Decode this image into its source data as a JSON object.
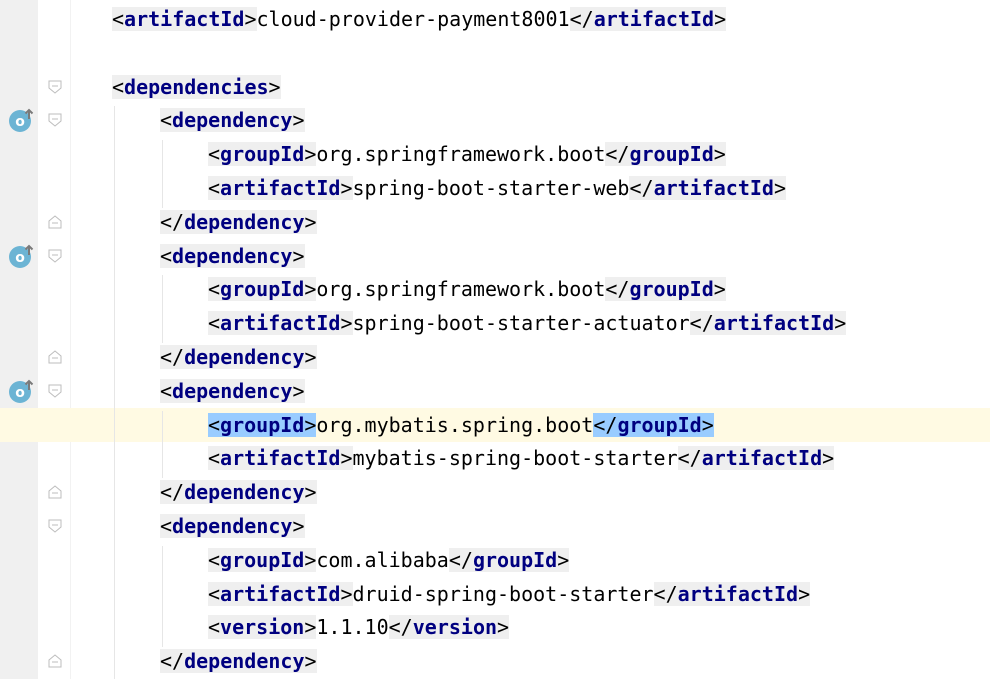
{
  "editor": {
    "lines": [
      {
        "indent": 0,
        "tag": "artifactId",
        "value": "cloud-provider-payment8001",
        "close": "artifactId",
        "fold": "",
        "marker": false,
        "current": false
      },
      {
        "indent": -1
      },
      {
        "indent": 0,
        "tag": "dependencies",
        "fold": "open",
        "marker": false,
        "current": false
      },
      {
        "indent": 1,
        "tag": "dependency",
        "fold": "open",
        "marker": true,
        "current": false
      },
      {
        "indent": 2,
        "tag": "groupId",
        "value": "org.springframework.boot",
        "close": "groupId"
      },
      {
        "indent": 2,
        "tag": "artifactId",
        "value": "spring-boot-starter-web",
        "close": "artifactId"
      },
      {
        "indent": 1,
        "closeOnly": "dependency",
        "fold": "close"
      },
      {
        "indent": 1,
        "tag": "dependency",
        "fold": "open",
        "marker": true
      },
      {
        "indent": 2,
        "tag": "groupId",
        "value": "org.springframework.boot",
        "close": "groupId"
      },
      {
        "indent": 2,
        "tag": "artifactId",
        "value": "spring-boot-starter-actuator",
        "close": "artifactId"
      },
      {
        "indent": 1,
        "closeOnly": "dependency",
        "fold": "close"
      },
      {
        "indent": 1,
        "tag": "dependency",
        "fold": "open",
        "marker": true
      },
      {
        "indent": 2,
        "tag": "groupId",
        "value": "org.mybatis.spring.boot",
        "close": "groupId",
        "current": true,
        "highlight": true
      },
      {
        "indent": 2,
        "tag": "artifactId",
        "value": "mybatis-spring-boot-starter",
        "close": "artifactId"
      },
      {
        "indent": 1,
        "closeOnly": "dependency",
        "fold": "close"
      },
      {
        "indent": 1,
        "tag": "dependency",
        "fold": "open"
      },
      {
        "indent": 2,
        "tag": "groupId",
        "value": "com.alibaba",
        "close": "groupId"
      },
      {
        "indent": 2,
        "tag": "artifactId",
        "value": "druid-spring-boot-starter",
        "close": "artifactId"
      },
      {
        "indent": 2,
        "tag": "version",
        "value": "1.1.10",
        "close": "version"
      },
      {
        "indent": 1,
        "closeOnly": "dependency",
        "fold": "close"
      }
    ]
  },
  "colors": {
    "tag_name": "#000080",
    "tag_bg": "#efefef",
    "tag_highlight": "#99ccff",
    "current_line": "#fffae3",
    "gutter": "#f0f0f0"
  },
  "icons": {
    "marker": "overriding-method-icon",
    "fold_open": "fold-open-icon",
    "fold_close": "fold-close-icon"
  }
}
